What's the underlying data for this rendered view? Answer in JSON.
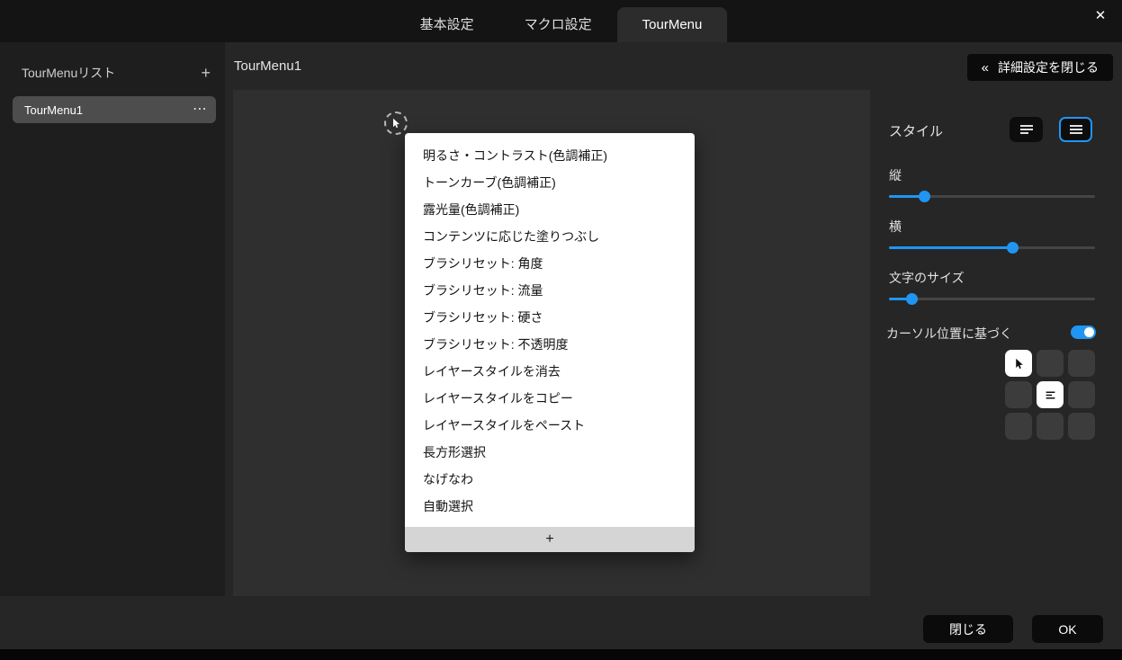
{
  "window": {
    "close_icon": "✕"
  },
  "titlebar": {
    "tabs": [
      {
        "label": "基本設定",
        "active": false
      },
      {
        "label": "マクロ設定",
        "active": false
      },
      {
        "label": "TourMenu",
        "active": true
      }
    ]
  },
  "sidebar": {
    "header": "TourMenuリスト",
    "add_icon": "+",
    "items": [
      {
        "label": "TourMenu1",
        "selected": true,
        "more_icon": "⋯"
      }
    ]
  },
  "main": {
    "title": "TourMenu1",
    "collapse_button": {
      "chevron": "«",
      "label": "詳細設定を閉じる"
    },
    "menu": {
      "items": [
        "明るさ・コントラスト(色調補正)",
        "トーンカーブ(色調補正)",
        "露光量(色調補正)",
        "コンテンツに応じた塗りつぶし",
        "ブラシリセット: 角度",
        "ブラシリセット: 流量",
        "ブラシリセット: 硬さ",
        "ブラシリセット: 不透明度",
        "レイヤースタイルを消去",
        "レイヤースタイルをコピー",
        "レイヤースタイルをペースト",
        "長方形選択",
        "なげなわ",
        "自動選択"
      ],
      "add_icon": "+"
    }
  },
  "settings": {
    "style_label": "スタイル",
    "style_buttons": [
      {
        "name": "list-style",
        "selected": false
      },
      {
        "name": "compact-style",
        "selected": true
      }
    ],
    "sliders": [
      {
        "label": "縦",
        "value": 17
      },
      {
        "label": "横",
        "value": 60
      },
      {
        "label": "文字のサイズ",
        "value": 11
      }
    ],
    "cursor_toggle": {
      "label": "カーソル位置に基づく",
      "on": true
    },
    "position_grid": {
      "cells": [
        {
          "icon": "cursor",
          "active": true
        },
        {
          "icon": "",
          "active": false
        },
        {
          "icon": "",
          "active": false
        },
        {
          "icon": "",
          "active": false
        },
        {
          "icon": "list",
          "active": true
        },
        {
          "icon": "",
          "active": false
        },
        {
          "icon": "",
          "active": false
        },
        {
          "icon": "",
          "active": false
        },
        {
          "icon": "",
          "active": false
        }
      ]
    }
  },
  "footer": {
    "close_label": "閉じる",
    "ok_label": "OK"
  },
  "colors": {
    "accent": "#2095f2",
    "menu_bg": "#ffffff",
    "selected_item_bg": "#4d4d4d"
  }
}
